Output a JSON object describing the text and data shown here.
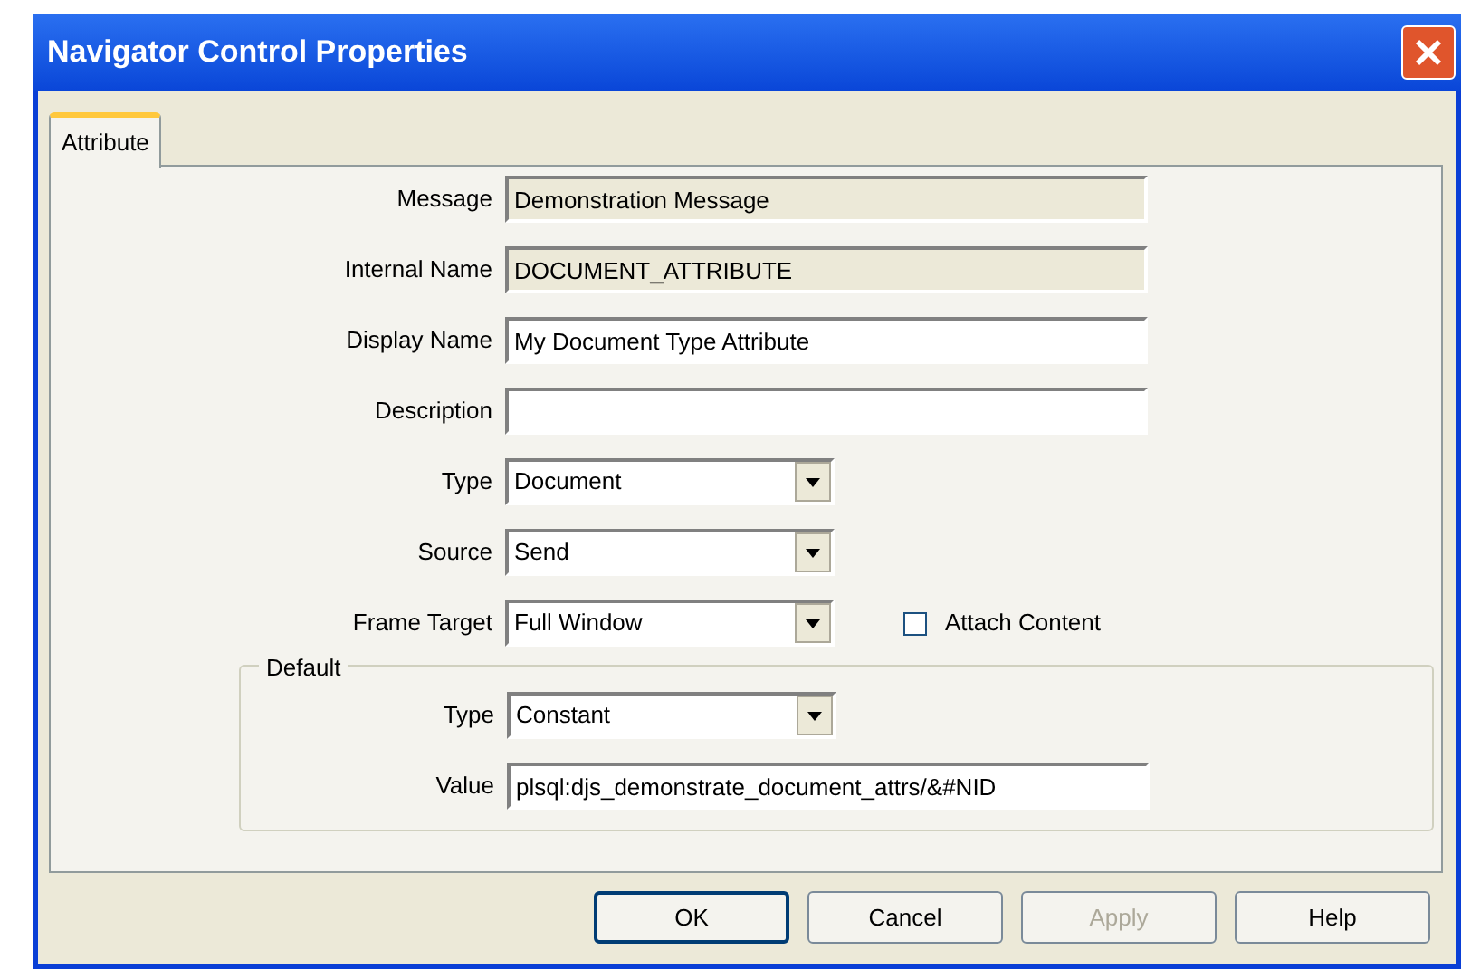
{
  "window": {
    "title": "Navigator Control Properties"
  },
  "tabs": [
    {
      "label": "Attribute",
      "selected": true
    }
  ],
  "fields": [
    {
      "kind": "text",
      "label": "Message",
      "value": "Demonstration Message",
      "readonly": true
    },
    {
      "kind": "text",
      "label": "Internal Name",
      "value": "DOCUMENT_ATTRIBUTE",
      "readonly": true
    },
    {
      "kind": "text",
      "label": "Display Name",
      "value": "My Document Type Attribute",
      "readonly": false
    },
    {
      "kind": "text",
      "label": "Description",
      "readonly": false
    },
    {
      "kind": "dropdown",
      "label": "Type",
      "value": "Document"
    },
    {
      "kind": "dropdown",
      "label": "Source",
      "value": "Send"
    },
    {
      "kind": "dropdown",
      "label": "Frame Target",
      "value": "Full Window",
      "checkbox": {
        "label": "Attach Content",
        "checked": false
      }
    }
  ],
  "default_group": {
    "title": "Default",
    "fields": [
      {
        "kind": "dropdown",
        "label": "Type",
        "value": "Constant"
      },
      {
        "kind": "text",
        "label": "Value",
        "value": "plsql:djs_demonstrate_document_attrs/&#NID",
        "readonly": false
      }
    ]
  },
  "buttons": [
    {
      "label": "OK",
      "default": true,
      "disabled": false
    },
    {
      "label": "Cancel",
      "default": false,
      "disabled": false
    },
    {
      "label": "Apply",
      "default": false,
      "disabled": true
    },
    {
      "label": "Help",
      "default": false,
      "disabled": false
    }
  ]
}
